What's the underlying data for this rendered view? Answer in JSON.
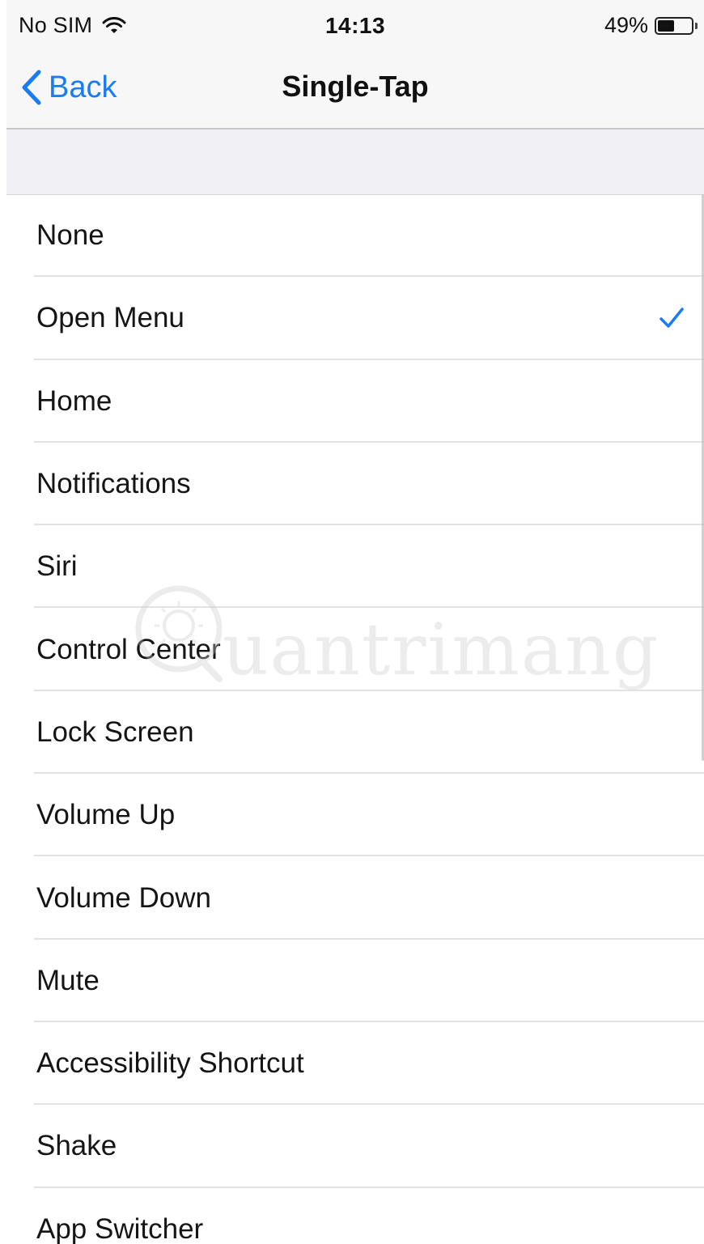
{
  "status_bar": {
    "carrier": "No SIM",
    "time": "14:13",
    "battery_percent_text": "49%",
    "battery_level": 0.49,
    "icons": [
      "wifi-icon",
      "battery-icon"
    ]
  },
  "nav": {
    "back_label": "Back",
    "title": "Single-Tap",
    "accent_color": "#1a7cf3"
  },
  "options": [
    {
      "label": "None",
      "selected": false
    },
    {
      "label": "Open Menu",
      "selected": true
    },
    {
      "label": "Home",
      "selected": false
    },
    {
      "label": "Notifications",
      "selected": false
    },
    {
      "label": "Siri",
      "selected": false
    },
    {
      "label": "Control Center",
      "selected": false
    },
    {
      "label": "Lock Screen",
      "selected": false
    },
    {
      "label": "Volume Up",
      "selected": false
    },
    {
      "label": "Volume Down",
      "selected": false
    },
    {
      "label": "Mute",
      "selected": false
    },
    {
      "label": "Accessibility Shortcut",
      "selected": false
    },
    {
      "label": "Shake",
      "selected": false
    },
    {
      "label": "App Switcher",
      "selected": false
    }
  ],
  "watermark": {
    "text": "uantrimang",
    "icon": "quantrimang-logo-icon"
  }
}
